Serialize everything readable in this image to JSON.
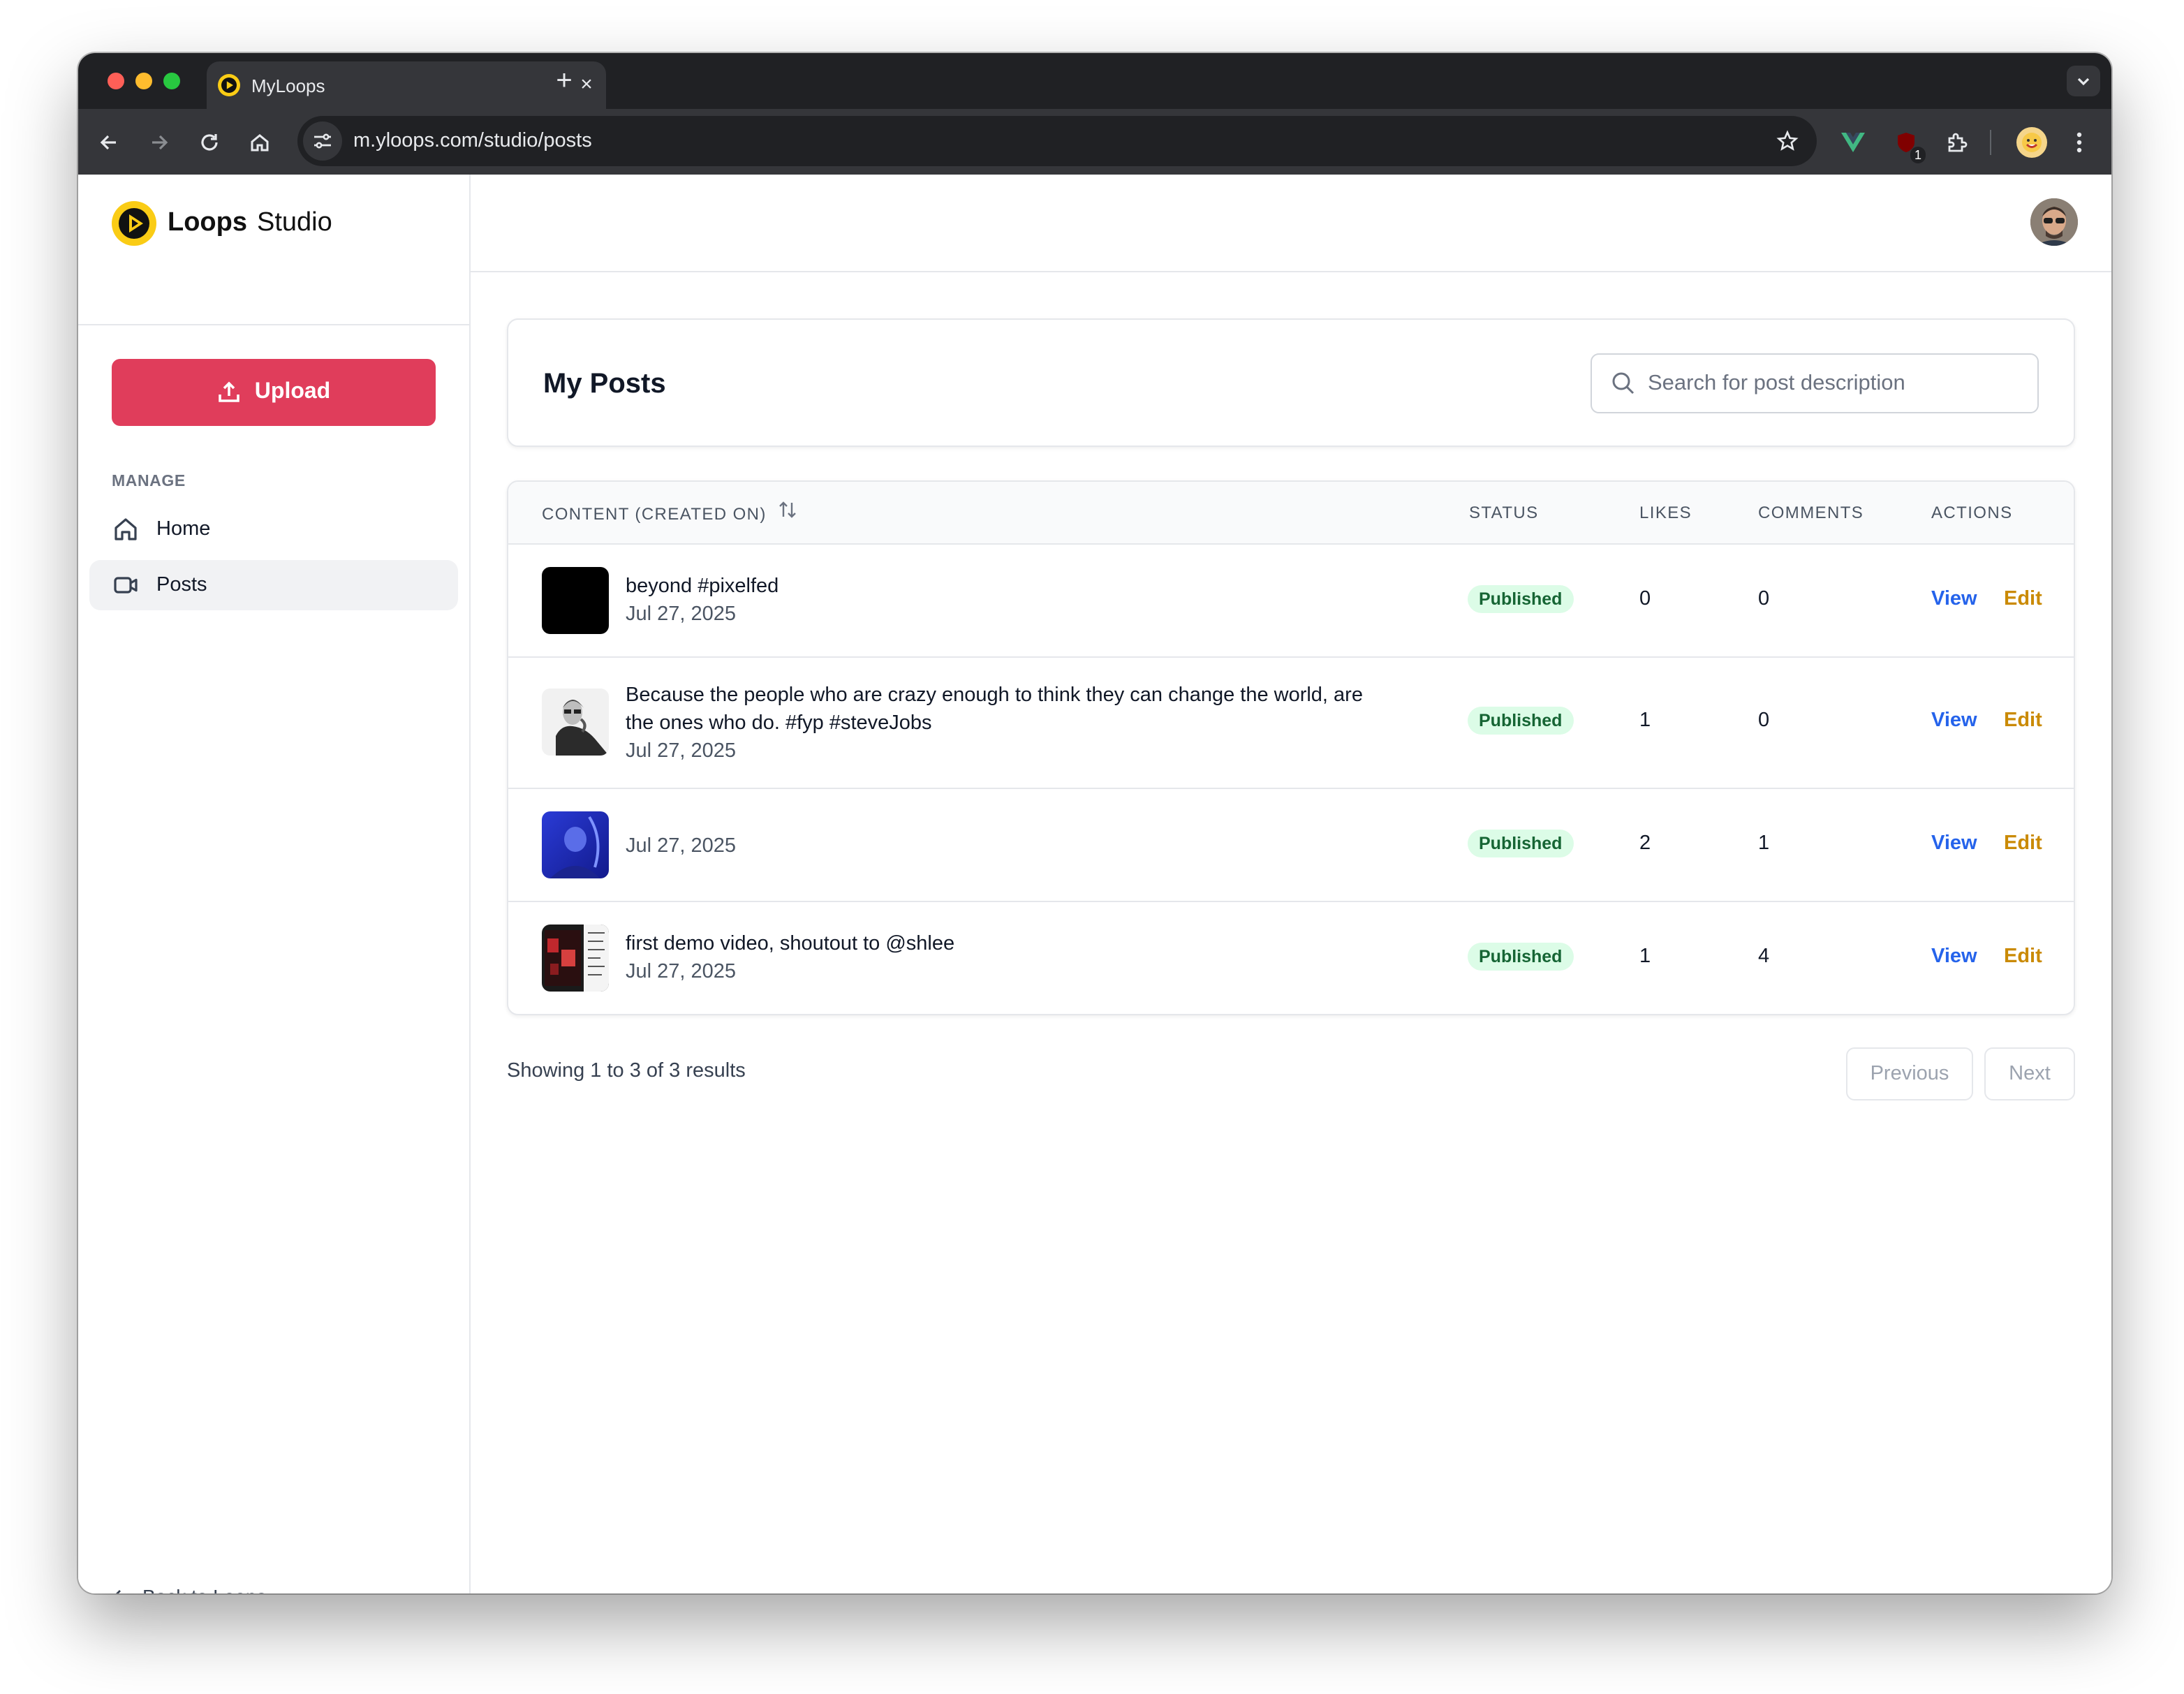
{
  "browser": {
    "tab_title": "MyLoops",
    "tab_close": "×",
    "new_tab": "+",
    "url": "m.yloops.com/studio/posts",
    "extension_badge": "1"
  },
  "sidebar": {
    "brand_bold": "Loops",
    "brand_light": "Studio",
    "upload_label": "Upload",
    "manage_label": "MANAGE",
    "nav": [
      {
        "label": "Home",
        "icon": "home-icon"
      },
      {
        "label": "Posts",
        "icon": "video-icon",
        "active": true
      }
    ],
    "back_label": "Back to Loops"
  },
  "main": {
    "title": "My Posts",
    "search_placeholder": "Search for post description",
    "columns": {
      "content": "CONTENT (CREATED ON)",
      "status": "STATUS",
      "likes": "LIKES",
      "comments": "COMMENTS",
      "actions": "ACTIONS"
    },
    "rows": [
      {
        "desc1": "beyond #pixelfed",
        "desc2": "",
        "date": "Jul 27, 2025",
        "status": "Published",
        "likes": "0",
        "comments": "0",
        "view": "View",
        "edit": "Edit"
      },
      {
        "desc1": "Because the people who are crazy enough to think they can change the world, are",
        "desc2": "the ones who do. #fyp #steveJobs",
        "date": "Jul 27, 2025",
        "status": "Published",
        "likes": "1",
        "comments": "0",
        "view": "View",
        "edit": "Edit"
      },
      {
        "desc1": "",
        "desc2": "",
        "date": "Jul 27, 2025",
        "status": "Published",
        "likes": "2",
        "comments": "1",
        "view": "View",
        "edit": "Edit"
      },
      {
        "desc1": "first demo video, shoutout to @shlee",
        "desc2": "",
        "date": "Jul 27, 2025",
        "status": "Published",
        "likes": "1",
        "comments": "4",
        "view": "View",
        "edit": "Edit"
      }
    ],
    "showing": "Showing 1 to 3 of 3 results",
    "prev_label": "Previous",
    "next_label": "Next"
  },
  "colors": {
    "upload": "#e03d5b",
    "published_bg": "#dcfce7",
    "published_text": "#166534",
    "view": "#2563eb",
    "edit": "#ca8a04"
  }
}
